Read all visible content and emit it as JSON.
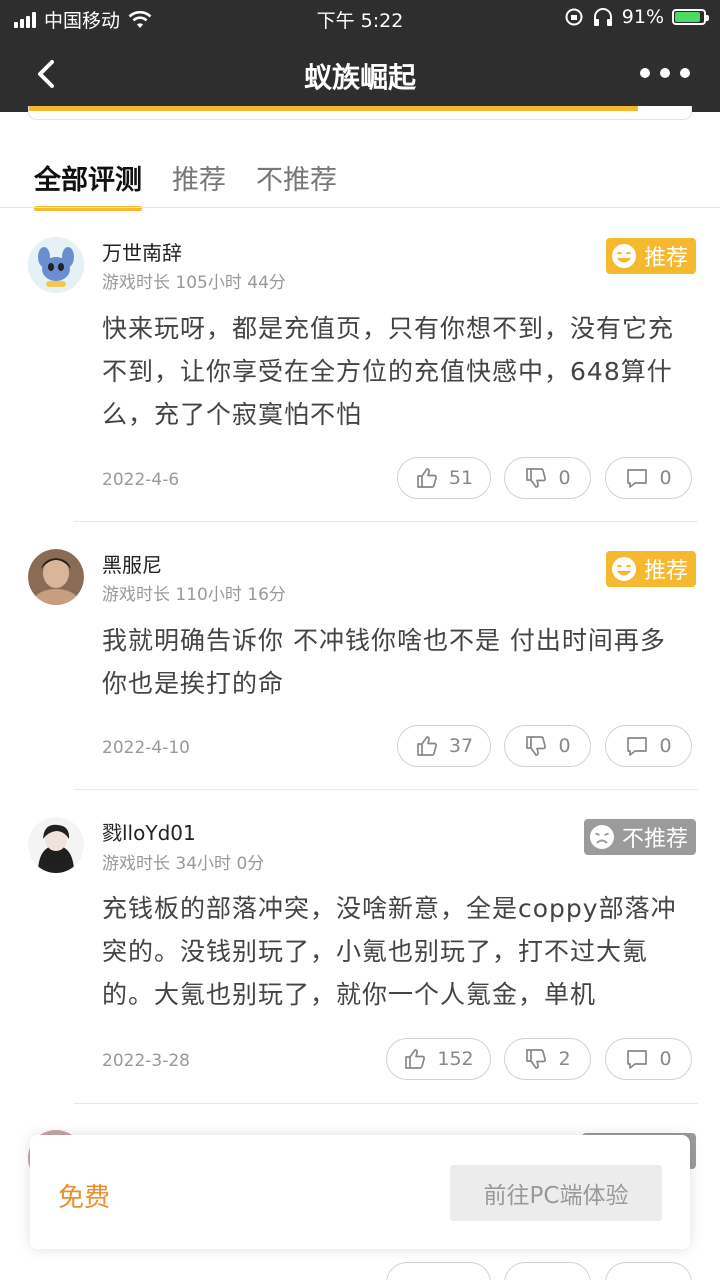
{
  "status_bar": {
    "carrier": "中国移动",
    "time": "下午 5:22",
    "battery": "91%",
    "battery_level": 0.91
  },
  "nav": {
    "title": "蚁族崛起"
  },
  "rating_bar_fill": 0.92,
  "tabs": [
    {
      "label": "全部评测",
      "active": true
    },
    {
      "label": "推荐",
      "active": false
    },
    {
      "label": "不推荐",
      "active": false
    }
  ],
  "reviews": [
    {
      "user": "万世南辞",
      "playtime": "游戏时长 105小时 44分",
      "badge": "推荐",
      "recommend": true,
      "content": "快来玩呀，都是充值页，只有你想不到，没有它充不到，让你享受在全方位的充值快感中，648算什么，充了个寂寞怕不怕",
      "date": "2022-4-6",
      "likes": "51",
      "dislikes": "0",
      "comments": "0"
    },
    {
      "user": "黑服尼",
      "playtime": "游戏时长 110小时 16分",
      "badge": "推荐",
      "recommend": true,
      "content": "我就明确告诉你 不冲钱你啥也不是 付出时间再多 你也是挨打的命",
      "date": "2022-4-10",
      "likes": "37",
      "dislikes": "0",
      "comments": "0"
    },
    {
      "user": "戮lloYd01",
      "playtime": "游戏时长 34小时 0分",
      "badge": "不推荐",
      "recommend": false,
      "content": "充钱板的部落冲突，没啥新意，全是coppy部落冲突的。没钱别玩了，小氪也别玩了，打不过大氪的。大氪也别玩了，就你一个人氪金，单机",
      "date": "2022-3-28",
      "likes": "152",
      "dislikes": "2",
      "comments": "0"
    }
  ],
  "popup": {
    "price": "免费",
    "pc_button": "前往PC端体验"
  },
  "colors": {
    "accent": "#f5b82e",
    "header": "#2e2e2e",
    "price": "#f08c2a",
    "not_recommend": "#9b9b9b"
  }
}
